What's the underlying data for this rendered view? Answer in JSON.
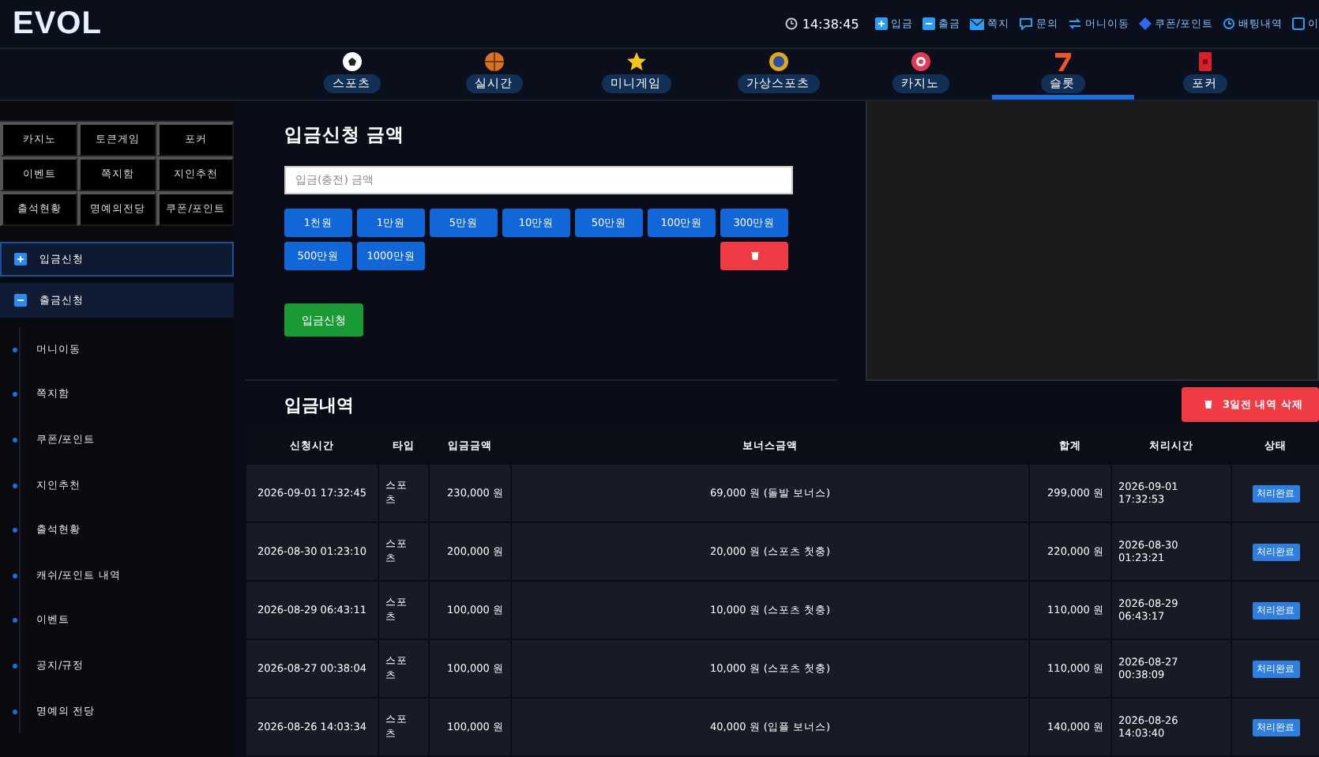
{
  "header": {
    "logo": "EVOL",
    "clock": "14:38:45",
    "links": [
      {
        "label": "입금",
        "kind": "plus"
      },
      {
        "label": "출금",
        "kind": "minus"
      },
      {
        "label": "쪽지",
        "kind": "mail"
      },
      {
        "label": "문의",
        "kind": "chat"
      },
      {
        "label": "머니이동",
        "kind": "swap"
      },
      {
        "label": "쿠폰/포인트",
        "kind": "tag"
      },
      {
        "label": "배팅내역",
        "kind": "history"
      },
      {
        "label": "이",
        "kind": "user"
      }
    ]
  },
  "nav": [
    {
      "label": "스포츠",
      "kind": "soccer",
      "selected": false
    },
    {
      "label": "실시간",
      "kind": "basketball",
      "selected": false
    },
    {
      "label": "미니게임",
      "kind": "star",
      "selected": false
    },
    {
      "label": "가상스포츠",
      "kind": "medal",
      "selected": false
    },
    {
      "label": "카지노",
      "kind": "chip",
      "selected": false
    },
    {
      "label": "슬롯",
      "kind": "slot",
      "selected": true
    },
    {
      "label": "포커",
      "kind": "card",
      "selected": false
    }
  ],
  "sidebar": {
    "quick_menu": [
      [
        "카지노",
        "토큰게임",
        "포커"
      ],
      [
        "이벤트",
        "쪽지함",
        "지인추천"
      ],
      [
        "출석현황",
        "명예의전당",
        "쿠폰/포인트"
      ]
    ],
    "menu": [
      {
        "label": "입금신청",
        "selected": true,
        "expanded": false
      },
      {
        "label": "출금신청",
        "selected": false,
        "expanded": true
      }
    ],
    "links": [
      "머니이동",
      "쪽지함",
      "쿠폰/포인트",
      "지인추천",
      "출석현황",
      "캐쉬/포인트 내역",
      "이벤트",
      "공지/규정",
      "명예의 전당"
    ]
  },
  "deposit_form": {
    "title": "입금신청 금액",
    "placeholder": "입금(충전) 금액",
    "amounts": [
      "1천원",
      "1만원",
      "5만원",
      "10만원",
      "50만원",
      "100만원",
      "300만원",
      "500만원",
      "1000만원"
    ],
    "submit": "입금신청"
  },
  "history": {
    "title": "입금내역",
    "delete_button": "3일전 내역 삭제",
    "columns": [
      "신청시간",
      "타입",
      "입금금액",
      "보너스금액",
      "합계",
      "처리시간",
      "상태"
    ],
    "rows": [
      [
        "2026-09-01 17:32:45",
        "스포츠",
        "230,000 원",
        "69,000 원 (돌발 보너스)",
        "299,000 원",
        "2026-09-01 17:32:53",
        "처리완료"
      ],
      [
        "2026-08-30 01:23:10",
        "스포츠",
        "200,000 원",
        "20,000 원 (스포츠 첫충)",
        "220,000 원",
        "2026-08-30 01:23:21",
        "처리완료"
      ],
      [
        "2026-08-29 06:43:11",
        "스포츠",
        "100,000 원",
        "10,000 원 (스포츠 첫충)",
        "110,000 원",
        "2026-08-29 06:43:17",
        "처리완료"
      ],
      [
        "2026-08-27 00:38:04",
        "스포츠",
        "100,000 원",
        "10,000 원 (스포츠 첫충)",
        "110,000 원",
        "2026-08-27 00:38:09",
        "처리완료"
      ],
      [
        "2026-08-26 14:03:34",
        "스포츠",
        "100,000 원",
        "40,000 원 (입플 보너스)",
        "140,000 원",
        "2026-08-26 14:03:40",
        "처리완료"
      ]
    ]
  }
}
